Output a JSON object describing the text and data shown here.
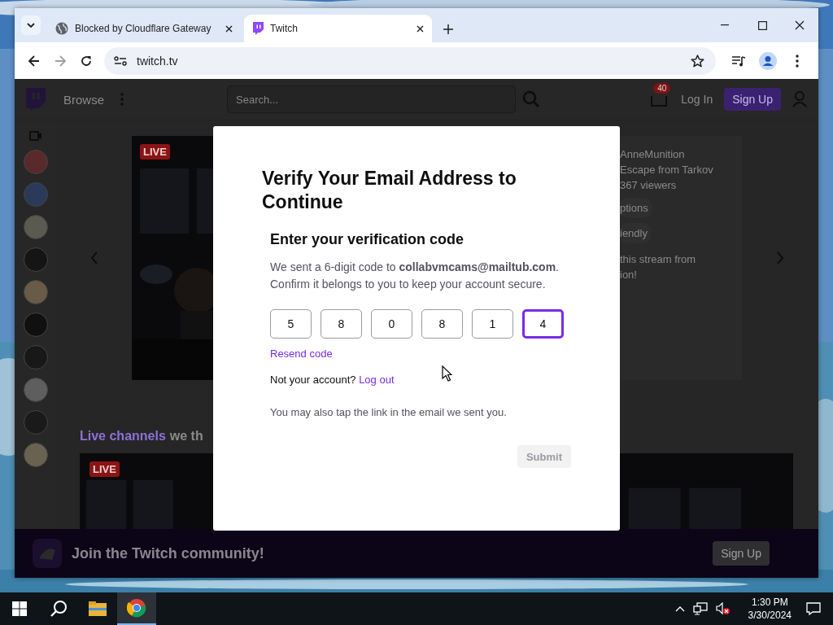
{
  "browser": {
    "tabs": [
      {
        "title": "Blocked by Cloudflare Gateway",
        "selected": false
      },
      {
        "title": "Twitch",
        "selected": true
      }
    ],
    "address": "twitch.tv"
  },
  "page": {
    "nav": {
      "browse": "Browse",
      "search_placeholder": "Search...",
      "notification_count": "40",
      "log_in": "Log In",
      "sign_up": "Sign Up"
    },
    "featured": {
      "live_badge": "LIVE",
      "channel": "AnneMunition",
      "game": "Escape from Tarkov",
      "viewers": "367 viewers",
      "tags": [
        "ptions",
        "iendly"
      ],
      "description_lines": [
        "this stream from",
        "ion!"
      ]
    },
    "section": {
      "link": "Live channels",
      "rest": "we th"
    },
    "thumbnails": [
      {
        "kind": "picture",
        "live_badge": "LIVE"
      },
      {
        "kind": "picture"
      }
    ],
    "banner": {
      "text": "Join the Twitch community!",
      "button": "Sign Up"
    }
  },
  "modal": {
    "title": "Verify Your Email Address to Continue",
    "heading": "Enter your verification code",
    "message": "We sent a 6-digit code to **collabvmcams@mailtub.com**. Confirm it belongs to you to keep your account secure.",
    "code": [
      {
        "digit": "5",
        "focused": false
      },
      {
        "digit": "8",
        "focused": false
      },
      {
        "digit": "0",
        "focused": false
      },
      {
        "digit": "8",
        "focused": false
      },
      {
        "digit": "1",
        "focused": false
      },
      {
        "digit": "4",
        "focused": true
      }
    ],
    "resend": "Resend code",
    "not_account": "Not your account?",
    "log_out": "Log out",
    "hint": "You may also tap the link in the email we sent you.",
    "submit": {
      "label": "Submit",
      "disabled": true
    }
  },
  "taskbar": {
    "time": "1:30 PM",
    "date": "3/30/2024",
    "apps": [
      {
        "selected": false
      },
      {
        "selected": true
      }
    ]
  }
}
